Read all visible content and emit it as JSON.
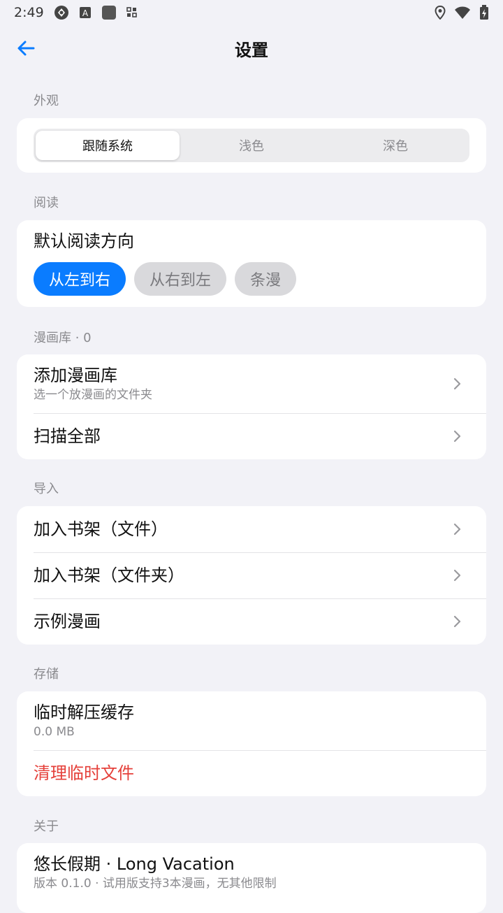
{
  "status_bar": {
    "time": "2:49",
    "icons": [
      "sync-icon",
      "text-a-icon",
      "app-square-icon",
      "grid-icon",
      "location-icon",
      "wifi-icon",
      "battery-charging-icon"
    ]
  },
  "header": {
    "title": "设置",
    "back_icon": "arrow-left-icon"
  },
  "appearance": {
    "label": "外观",
    "options": [
      "跟随系统",
      "浅色",
      "深色"
    ],
    "selected": "跟随系统"
  },
  "reading": {
    "label": "阅读",
    "direction_title": "默认阅读方向",
    "options": [
      "从左到右",
      "从右到左",
      "条漫"
    ],
    "selected": "从左到右"
  },
  "library": {
    "label": "漫画库 · 0",
    "items": [
      {
        "title": "添加漫画库",
        "subtitle": "选一个放漫画的文件夹"
      },
      {
        "title": "扫描全部"
      }
    ]
  },
  "import": {
    "label": "导入",
    "items": [
      {
        "title": "加入书架（文件）"
      },
      {
        "title": "加入书架（文件夹）"
      },
      {
        "title": "示例漫画"
      }
    ]
  },
  "storage": {
    "label": "存储",
    "cache_title": "临时解压缓存",
    "cache_size": "0.0 MB",
    "clear_label": "清理临时文件"
  },
  "about": {
    "label": "关于",
    "app_name": "悠长假期 · Long Vacation",
    "version_info": "版本 0.1.0 · 试用版支持3本漫画，无其他限制"
  },
  "colors": {
    "accent": "#0a7cff",
    "danger": "#e5403a",
    "background": "#f2f2f7",
    "card": "#ffffff",
    "secondary_text": "#8a8a8e"
  }
}
